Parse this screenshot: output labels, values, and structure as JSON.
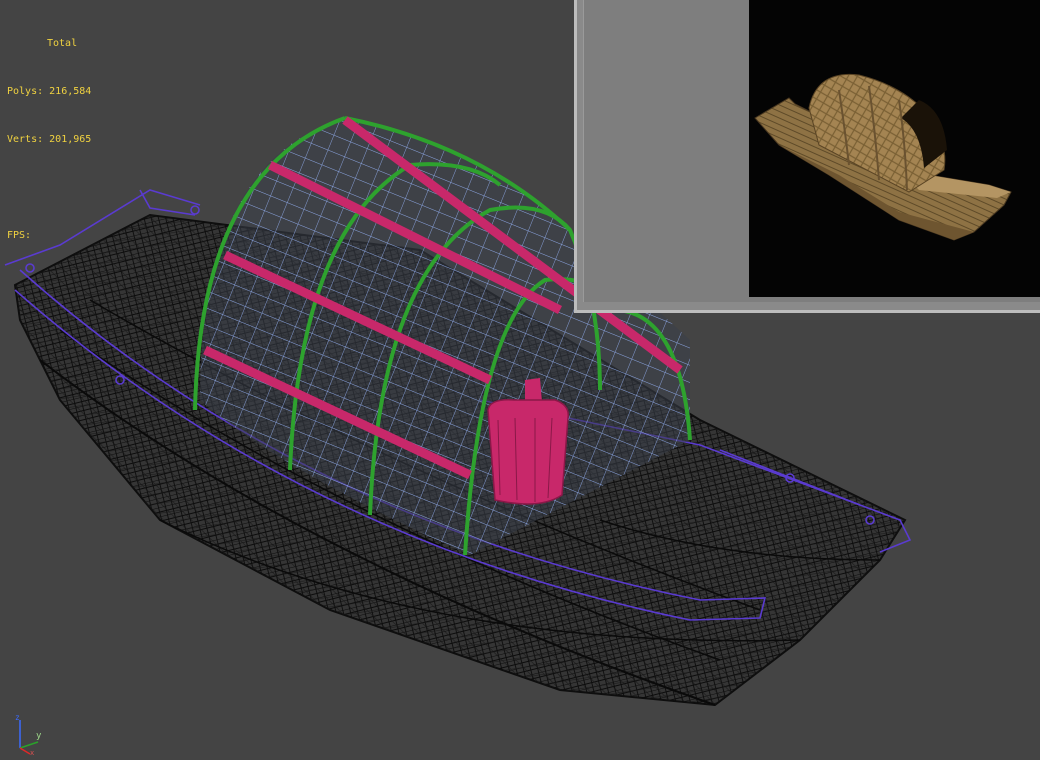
{
  "stats": {
    "header": "Total",
    "polys_label": "Polys:",
    "polys_value": "216,584",
    "verts_label": "Verts:",
    "verts_value": "201,965",
    "fps_label": "FPS:"
  },
  "gizmo": {
    "x_label": "x",
    "y_label": "y",
    "z_label": "z"
  },
  "colors": {
    "viewport_bg": "#444444",
    "stats_text": "#f0d240",
    "hull_wire": "#101010",
    "canopy_frame": "#2ea22e",
    "canopy_grid": "#8fb4ff",
    "slats": "#c8286a",
    "rail": "#5a3bd0",
    "render_bg": "#040404",
    "boat_wood": "#9a7a48"
  },
  "icons": {
    "axis": "axis-gizmo-icon"
  }
}
